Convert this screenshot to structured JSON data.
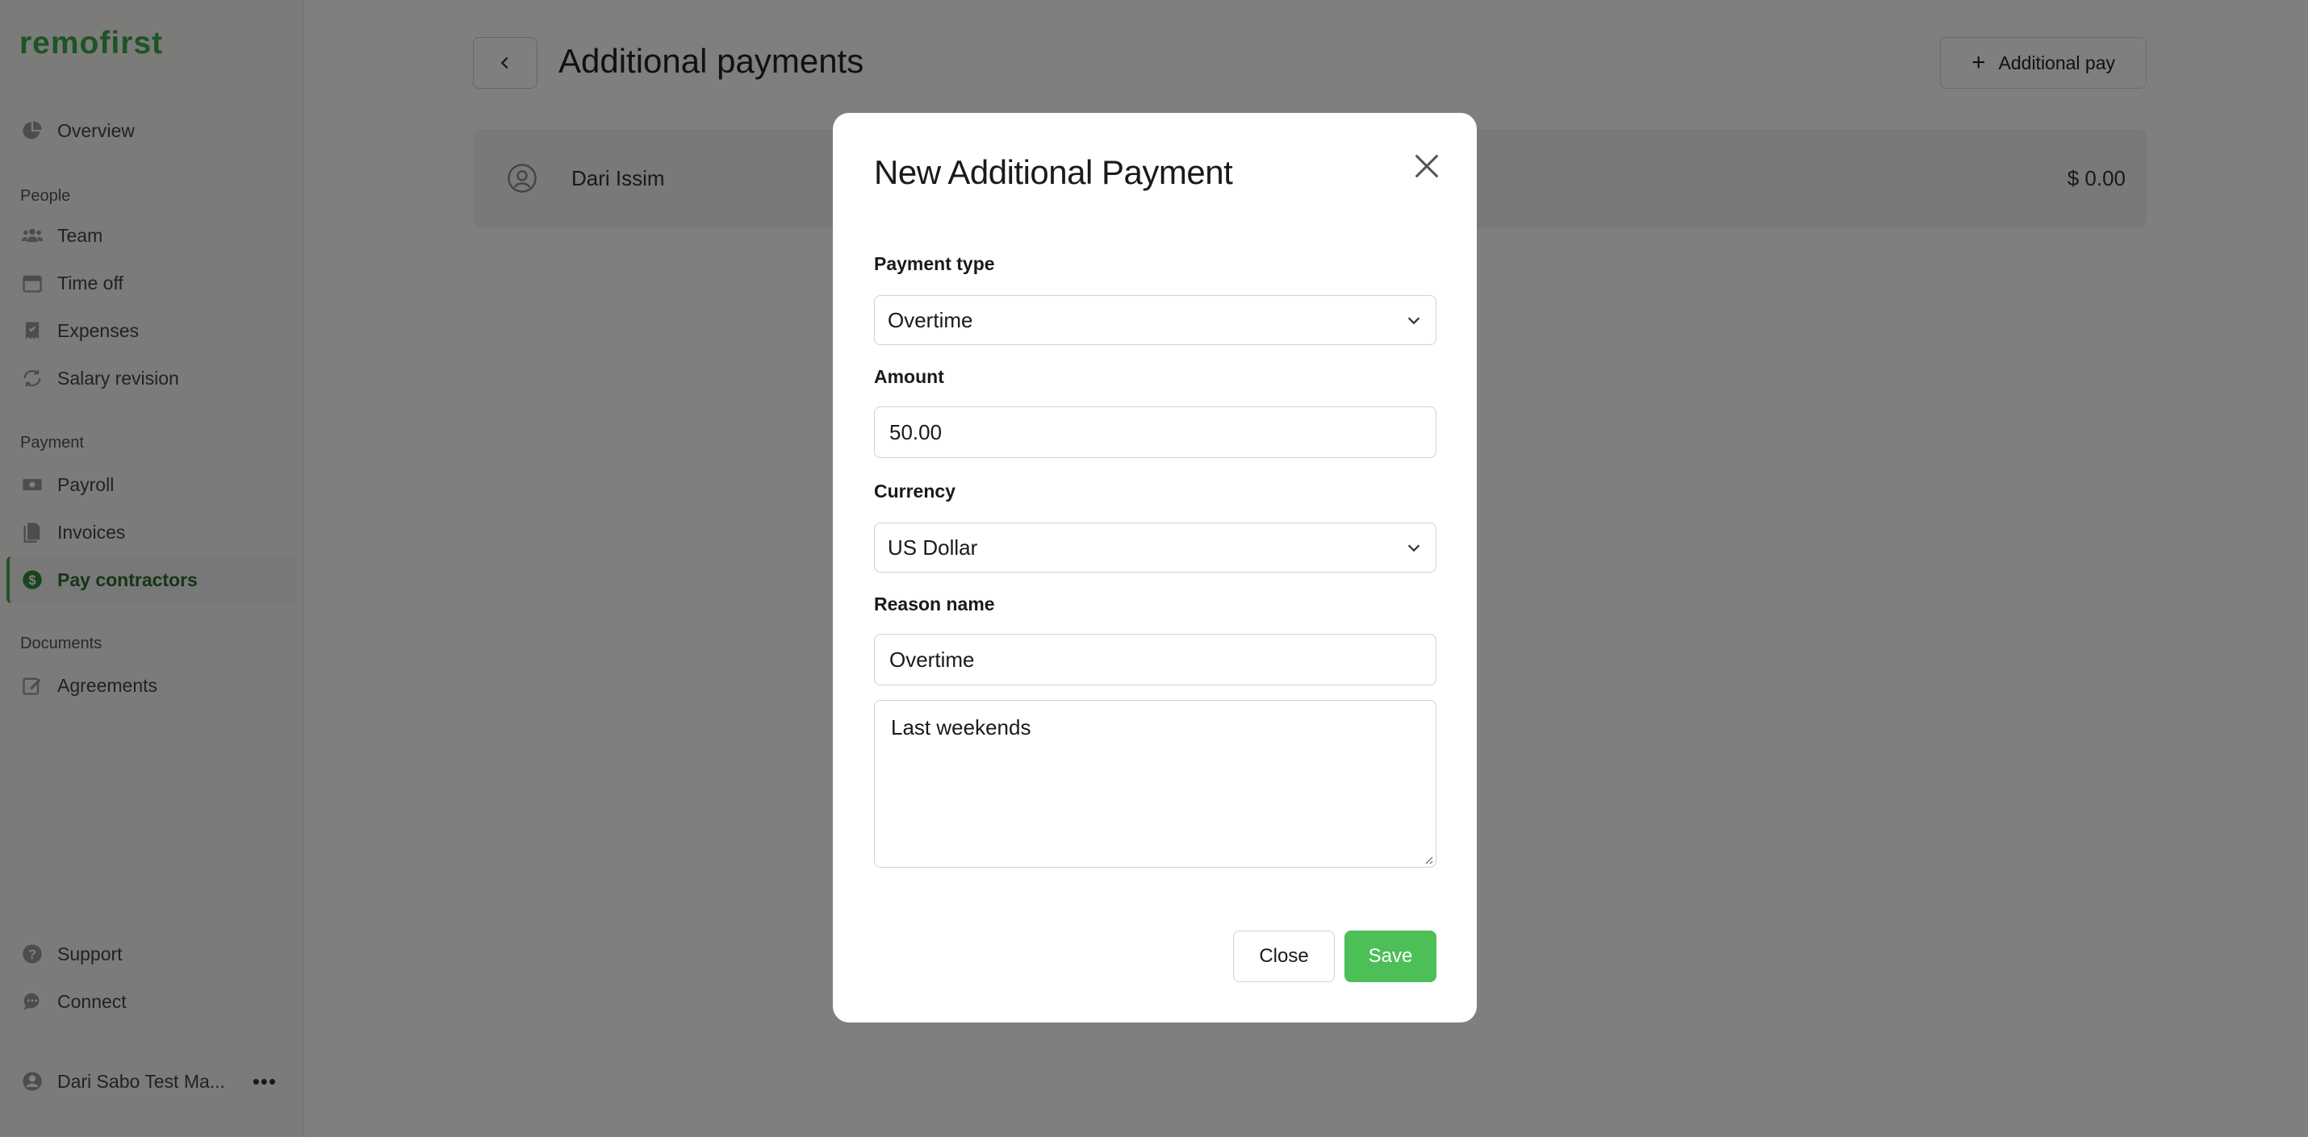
{
  "brand": {
    "logo_text": "remofirst",
    "accent_color": "#3aa84a"
  },
  "sidebar": {
    "items_top": [
      {
        "label": "Overview",
        "icon": "pie-chart-icon"
      }
    ],
    "sections": [
      {
        "title": "People",
        "items": [
          {
            "label": "Team",
            "icon": "users-icon"
          },
          {
            "label": "Time off",
            "icon": "calendar-icon"
          },
          {
            "label": "Expenses",
            "icon": "receipt-icon"
          },
          {
            "label": "Salary revision",
            "icon": "refresh-icon"
          }
        ]
      },
      {
        "title": "Payment",
        "items": [
          {
            "label": "Payroll",
            "icon": "money-icon"
          },
          {
            "label": "Invoices",
            "icon": "documents-icon"
          },
          {
            "label": "Pay contractors",
            "icon": "dollar-circle-icon",
            "active": true
          }
        ]
      },
      {
        "title": "Documents",
        "items": [
          {
            "label": "Agreements",
            "icon": "edit-icon"
          }
        ]
      }
    ],
    "bottom": [
      {
        "label": "Support",
        "icon": "help-icon"
      },
      {
        "label": "Connect",
        "icon": "chat-icon"
      }
    ],
    "user": {
      "name": "Dari Sabo Test Ma...",
      "more": "•••"
    }
  },
  "main": {
    "title": "Additional payments",
    "add_button_label": "Additional pay",
    "row": {
      "name": "Dari Issim",
      "amount": "$ 0.00"
    }
  },
  "modal": {
    "title": "New Additional Payment",
    "payment_type": {
      "label": "Payment type",
      "value": "Overtime"
    },
    "amount": {
      "label": "Amount",
      "value": "50.00"
    },
    "currency": {
      "label": "Currency",
      "value": "US Dollar"
    },
    "reason": {
      "label": "Reason name",
      "value": "Overtime"
    },
    "note": {
      "value": "Last weekends"
    },
    "close_label": "Close",
    "save_label": "Save",
    "save_color": "#4cbf57"
  }
}
